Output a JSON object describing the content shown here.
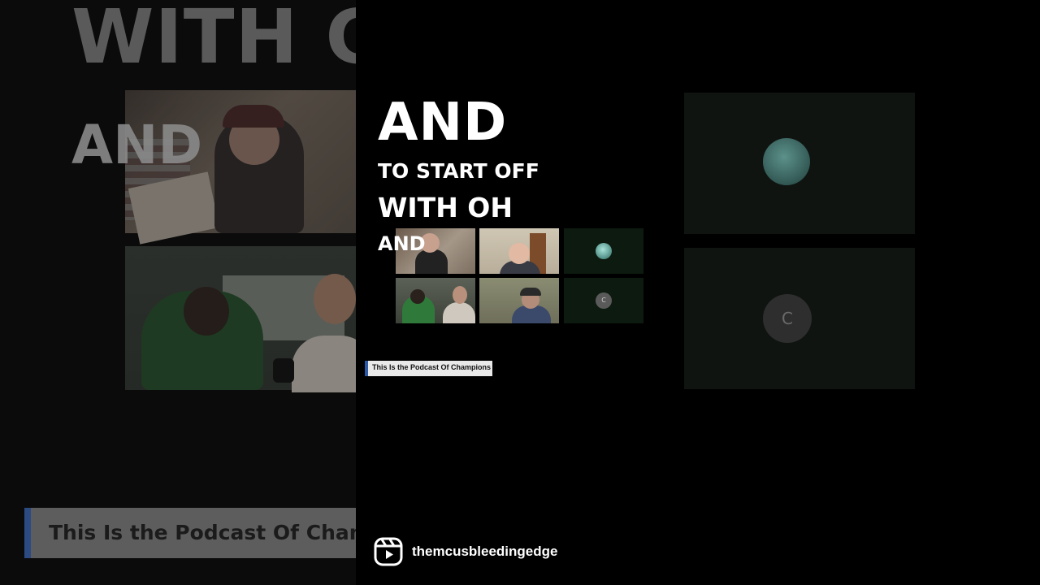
{
  "background": {
    "big_word": "WITH C",
    "small_word": "AND",
    "banner_text": "This Is the Podcast Of Champions",
    "avatar_letter": "C"
  },
  "captions": {
    "line1": "AND",
    "line2": "TO START OFF",
    "line3": "WITH OH",
    "line4": "AND"
  },
  "grid": {
    "avatar_letter": "C"
  },
  "lower_third": {
    "text": "This Is the Podcast Of Champions"
  },
  "channel": {
    "name": "themcusbleedingedge",
    "icon": "reels-icon"
  },
  "colors": {
    "background": "#000000",
    "caption": "#ffffff",
    "accent_blue": "#2d5aa8"
  }
}
